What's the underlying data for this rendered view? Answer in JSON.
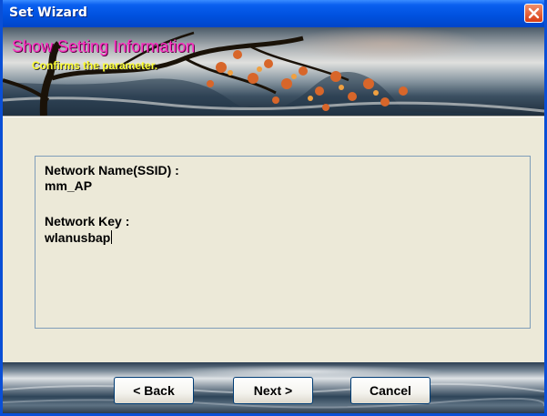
{
  "window": {
    "title": "Set Wizard"
  },
  "banner": {
    "title": "Show Setting Information",
    "subtitle": "Confirms the parameter."
  },
  "info": {
    "network_name_label": "Network Name(SSID) :",
    "network_name_value": "mm_AP",
    "network_key_label": "Network Key :",
    "network_key_value": "wlanusbap"
  },
  "buttons": {
    "back": "< Back",
    "next": "Next >",
    "cancel": "Cancel"
  },
  "icons": {
    "close": "close-icon"
  },
  "colors": {
    "title_bar": "#0a5fef",
    "banner_title": "#ff2fc4",
    "banner_subtitle": "#ffff33",
    "dialog_bg": "#ece9d8",
    "close_button": "#d83c14"
  }
}
